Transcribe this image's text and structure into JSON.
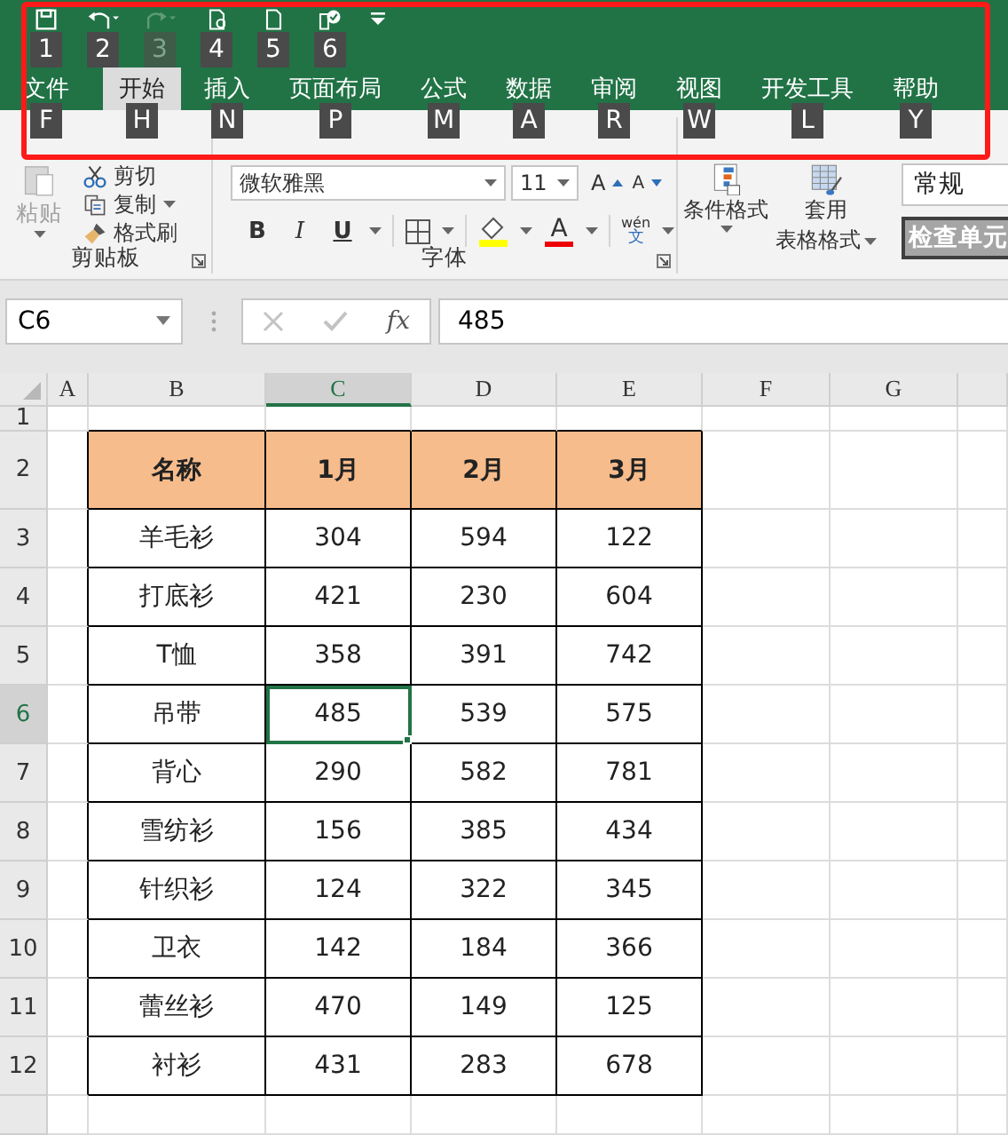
{
  "quick_access": [
    {
      "kind": "save",
      "keytip": "1",
      "disabled": false
    },
    {
      "kind": "undo",
      "keytip": "2",
      "disabled": false
    },
    {
      "kind": "redo",
      "keytip": "3",
      "disabled": true
    },
    {
      "kind": "new",
      "keytip": "4",
      "disabled": false
    },
    {
      "kind": "page",
      "keytip": "5",
      "disabled": false
    },
    {
      "kind": "check",
      "keytip": "6",
      "disabled": false
    }
  ],
  "tabs": [
    {
      "label": "文件",
      "keytip": "F",
      "selected": false
    },
    {
      "label": "开始",
      "keytip": "H",
      "selected": true
    },
    {
      "label": "插入",
      "keytip": "N",
      "selected": false
    },
    {
      "label": "页面布局",
      "keytip": "P",
      "selected": false
    },
    {
      "label": "公式",
      "keytip": "M",
      "selected": false
    },
    {
      "label": "数据",
      "keytip": "A",
      "selected": false
    },
    {
      "label": "审阅",
      "keytip": "R",
      "selected": false
    },
    {
      "label": "视图",
      "keytip": "W",
      "selected": false
    },
    {
      "label": "开发工具",
      "keytip": "L",
      "selected": false
    },
    {
      "label": "帮助",
      "keytip": "Y",
      "selected": false
    }
  ],
  "ribbon": {
    "paste": "粘贴",
    "cut": "剪切",
    "copy": "复制",
    "format_painter": "格式刷",
    "clipboard_label": "剪贴板",
    "font_name": "微软雅黑",
    "font_size": "11",
    "grow": "A",
    "shrink": "A",
    "bold": "B",
    "italic": "I",
    "underline": "U",
    "font_color": "A",
    "phonetic": "wén",
    "phonetic_char": "文",
    "font_label": "字体",
    "conditional_format": "条件格式",
    "table_format": [
      "套用",
      "表格格式"
    ],
    "number_format": "常规",
    "cell_style": "检查单元"
  },
  "name_box": "C6",
  "function_label": "fx",
  "formula": "485",
  "sheet": {
    "columns": [
      {
        "label": "A",
        "selected": false
      },
      {
        "label": "B",
        "selected": false
      },
      {
        "label": "C",
        "selected": true
      },
      {
        "label": "D",
        "selected": false
      },
      {
        "label": "E",
        "selected": false
      },
      {
        "label": "F",
        "selected": false
      },
      {
        "label": "G",
        "selected": false
      }
    ],
    "rows": [
      {
        "label": "1",
        "selected": false
      },
      {
        "label": "2",
        "selected": false
      },
      {
        "label": "3",
        "selected": false
      },
      {
        "label": "4",
        "selected": false
      },
      {
        "label": "5",
        "selected": false
      },
      {
        "label": "6",
        "selected": true
      },
      {
        "label": "7",
        "selected": false
      },
      {
        "label": "8",
        "selected": false
      },
      {
        "label": "9",
        "selected": false
      },
      {
        "label": "10",
        "selected": false
      },
      {
        "label": "11",
        "selected": false
      },
      {
        "label": "12",
        "selected": false
      }
    ],
    "table": {
      "header": [
        "名称",
        "1月",
        "2月",
        "3月"
      ],
      "rows": [
        {
          "cells": [
            {
              "text": "羊毛衫",
              "selected": false
            },
            {
              "text": "304",
              "selected": false
            },
            {
              "text": "594",
              "selected": false
            },
            {
              "text": "122",
              "selected": false
            }
          ]
        },
        {
          "cells": [
            {
              "text": "打底衫",
              "selected": false
            },
            {
              "text": "421",
              "selected": false
            },
            {
              "text": "230",
              "selected": false
            },
            {
              "text": "604",
              "selected": false
            }
          ]
        },
        {
          "cells": [
            {
              "text": "T恤",
              "selected": false
            },
            {
              "text": "358",
              "selected": false
            },
            {
              "text": "391",
              "selected": false
            },
            {
              "text": "742",
              "selected": false
            }
          ]
        },
        {
          "cells": [
            {
              "text": "吊带",
              "selected": false
            },
            {
              "text": "485",
              "selected": true
            },
            {
              "text": "539",
              "selected": false
            },
            {
              "text": "575",
              "selected": false
            }
          ]
        },
        {
          "cells": [
            {
              "text": "背心",
              "selected": false
            },
            {
              "text": "290",
              "selected": false
            },
            {
              "text": "582",
              "selected": false
            },
            {
              "text": "781",
              "selected": false
            }
          ]
        },
        {
          "cells": [
            {
              "text": "雪纺衫",
              "selected": false
            },
            {
              "text": "156",
              "selected": false
            },
            {
              "text": "385",
              "selected": false
            },
            {
              "text": "434",
              "selected": false
            }
          ]
        },
        {
          "cells": [
            {
              "text": "针织衫",
              "selected": false
            },
            {
              "text": "124",
              "selected": false
            },
            {
              "text": "322",
              "selected": false
            },
            {
              "text": "345",
              "selected": false
            }
          ]
        },
        {
          "cells": [
            {
              "text": "卫衣",
              "selected": false
            },
            {
              "text": "142",
              "selected": false
            },
            {
              "text": "184",
              "selected": false
            },
            {
              "text": "366",
              "selected": false
            }
          ]
        },
        {
          "cells": [
            {
              "text": "蕾丝衫",
              "selected": false
            },
            {
              "text": "470",
              "selected": false
            },
            {
              "text": "149",
              "selected": false
            },
            {
              "text": "125",
              "selected": false
            }
          ]
        },
        {
          "cells": [
            {
              "text": "衬衫",
              "selected": false
            },
            {
              "text": "431",
              "selected": false
            },
            {
              "text": "283",
              "selected": false
            },
            {
              "text": "678",
              "selected": false
            }
          ]
        }
      ]
    }
  }
}
